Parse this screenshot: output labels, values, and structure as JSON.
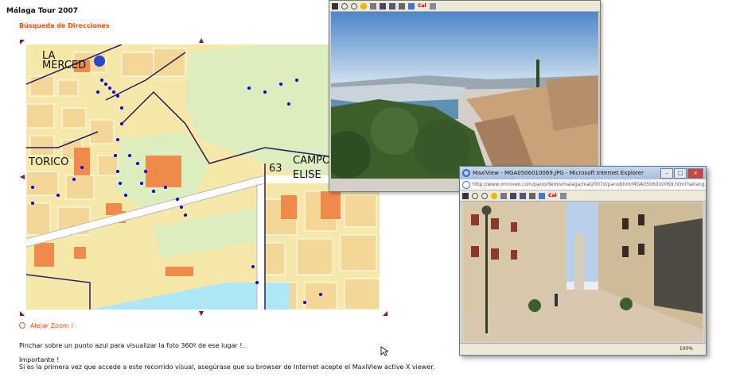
{
  "page": {
    "title": "Málaga Tour 2007",
    "search_link": "Búsqueda de Direcciones",
    "zoom_out_label": "Alejar Zoom !",
    "instruction": "Pinchar sobre un punto azul para visualizar la foto 360º de ese lugar !.",
    "important_heading": "Importante !",
    "important_text": "Si es la primera vez que accede a este recorrido visual, asegúrase que su browser de Internet acepte el MaxiView active X viewer."
  },
  "map": {
    "labels": {
      "la": "LA",
      "merced": "MERCED",
      "torico": "TORICO",
      "district_number": "63",
      "campo": "CAMPO",
      "elise": "ELISE"
    },
    "colors": {
      "background": "#f6e8a8",
      "blocks": "#f3d796",
      "park": "#dcedc0",
      "sea": "#aee8f7",
      "roads": "#ffffff",
      "orange": "#f08a4b",
      "borders": "#2a1d5a",
      "points": "#0000ee"
    }
  },
  "viewer1": {
    "toolbar_label": "Cal"
  },
  "viewer2": {
    "title": "MaxiView - MGA0506010069.JPG - Microsoft Internet Explorer",
    "url": "http://www.omniveo.com/pano/demo/malaga/mal2007d/panohtml/MGA0506010069.html?setang",
    "toolbar_label": "Cal",
    "zoom": "100%"
  }
}
